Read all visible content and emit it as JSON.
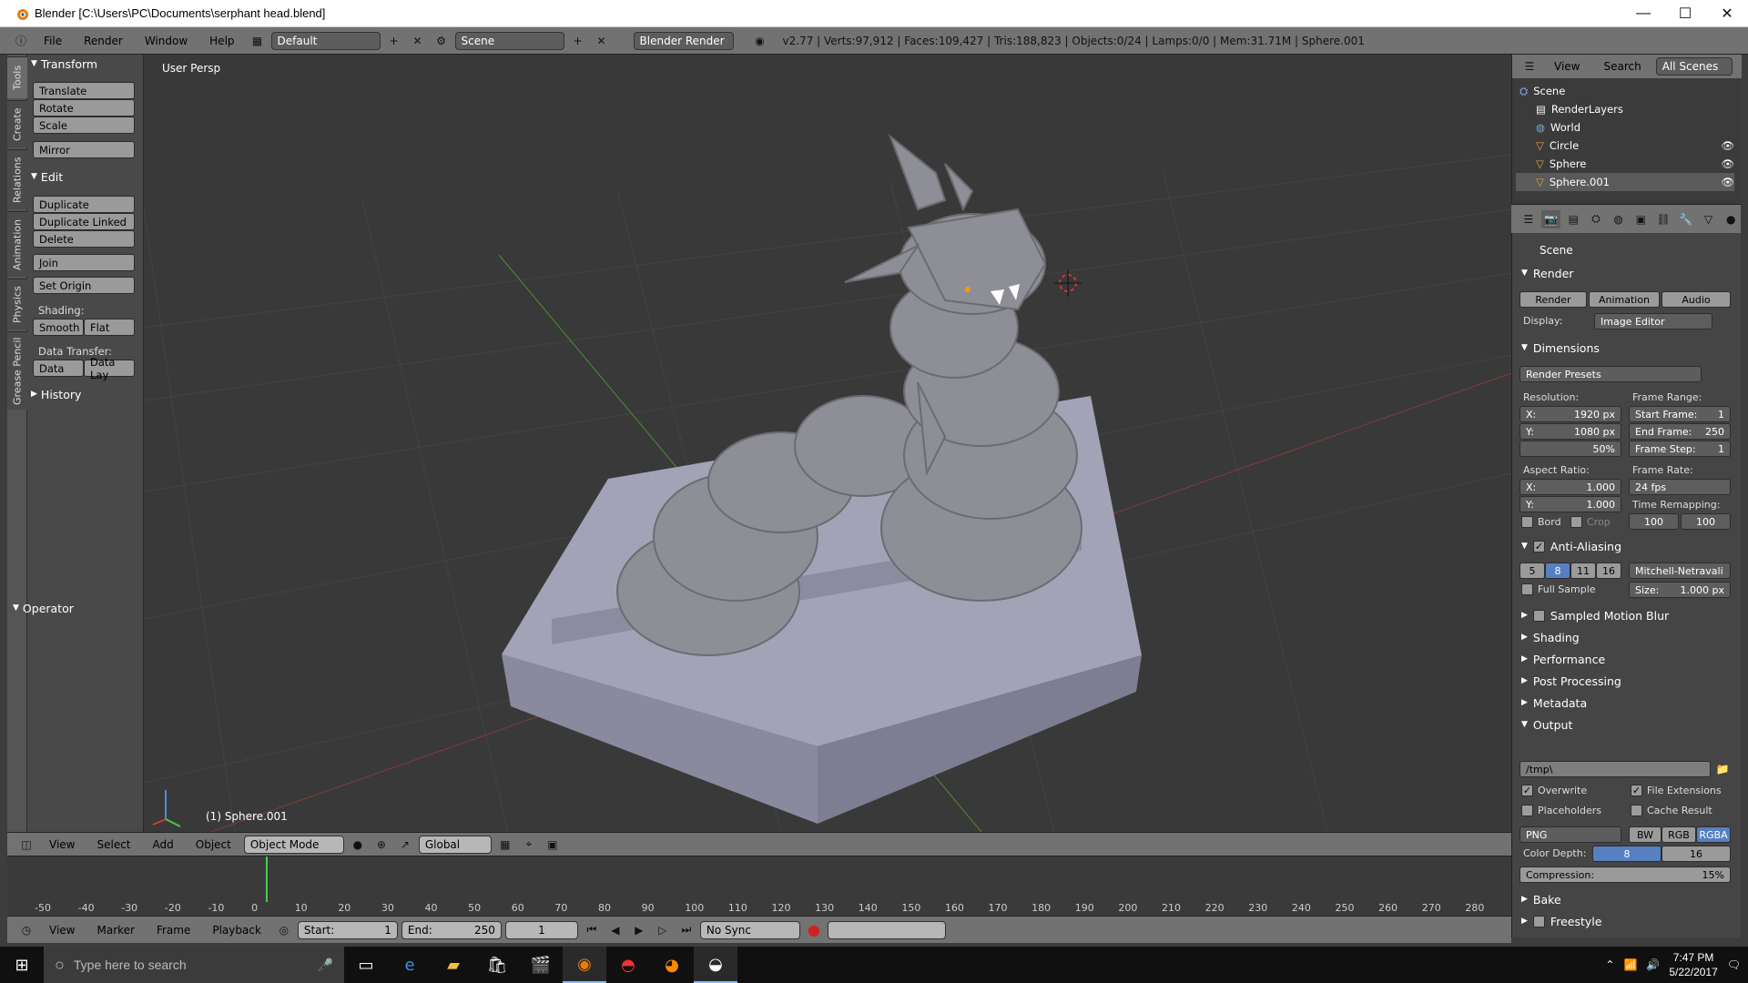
{
  "window": {
    "title": "Blender [C:\\Users\\PC\\Documents\\serphant head.blend]",
    "min": "—",
    "max": "☐",
    "close": "✕"
  },
  "info": {
    "menus": [
      "File",
      "Render",
      "Window",
      "Help"
    ],
    "layout": "Default",
    "scene": "Scene",
    "engine": "Blender Render",
    "stats": "v2.77 | Verts:97,912 | Faces:109,427 | Tris:188,823 | Objects:0/24 | Lamps:0/0 | Mem:31.71M | Sphere.001"
  },
  "vtabs": [
    "Tools",
    "Create",
    "Relations",
    "Animation",
    "Physics",
    "Grease Pencil"
  ],
  "toolshelf": {
    "transform_title": "Transform",
    "translate": "Translate",
    "rotate": "Rotate",
    "scale": "Scale",
    "mirror": "Mirror",
    "edit_title": "Edit",
    "duplicate": "Duplicate",
    "duplicate_linked": "Duplicate Linked",
    "delete": "Delete",
    "join": "Join",
    "set_origin": "Set Origin",
    "shading_label": "Shading:",
    "smooth": "Smooth",
    "flat": "Flat",
    "data_transfer_label": "Data Transfer:",
    "data": "Data",
    "data_lay": "Data Lay",
    "history_title": "History",
    "operator_title": "Operator"
  },
  "viewport": {
    "view_label": "User Persp",
    "object_label": "(1) Sphere.001"
  },
  "vphead": {
    "menus": [
      "View",
      "Select",
      "Add",
      "Object"
    ],
    "mode": "Object Mode",
    "orientation": "Global"
  },
  "timeline": {
    "ticks": [
      "-50",
      "-40",
      "-30",
      "-20",
      "-10",
      "0",
      "10",
      "20",
      "30",
      "40",
      "50",
      "60",
      "70",
      "80",
      "90",
      "100",
      "110",
      "120",
      "130",
      "140",
      "150",
      "160",
      "170",
      "180",
      "190",
      "200",
      "210",
      "220",
      "230",
      "240",
      "250",
      "260",
      "270",
      "280"
    ],
    "menus": [
      "View",
      "Marker",
      "Frame",
      "Playback"
    ],
    "start_label": "Start:",
    "start": "1",
    "end_label": "End:",
    "end": "250",
    "current": "1",
    "sync": "No Sync"
  },
  "outliner": {
    "menus": [
      "View",
      "Search"
    ],
    "filter": "All Scenes",
    "rows": [
      "Scene",
      "RenderLayers",
      "World",
      "Circle",
      "Sphere",
      "Sphere.001"
    ]
  },
  "props": {
    "context": "Scene",
    "render_title": "Render",
    "render_btn": "Render",
    "animation_btn": "Animation",
    "audio_btn": "Audio",
    "display_label": "Display:",
    "display_value": "Image Editor",
    "dimensions_title": "Dimensions",
    "render_presets": "Render Presets",
    "resolution_label": "Resolution:",
    "res_x": "X:",
    "res_x_val": "1920 px",
    "res_y": "Y:",
    "res_y_val": "1080 px",
    "res_pct": "50%",
    "frame_range_label": "Frame Range:",
    "start_frame": "Start Frame:",
    "start_frame_val": "1",
    "end_frame": "End Frame:",
    "end_frame_val": "250",
    "frame_step": "Frame Step:",
    "frame_step_val": "1",
    "aspect_label": "Aspect Ratio:",
    "asp_x": "X:",
    "asp_x_val": "1.000",
    "asp_y": "Y:",
    "asp_y_val": "1.000",
    "frame_rate_label": "Frame Rate:",
    "frame_rate_val": "24 fps",
    "time_remap_label": "Time Remapping:",
    "remap_old": "100",
    "remap_new": "100",
    "bord": "Bord",
    "crop": "Crop",
    "aa_title": "Anti-Aliasing",
    "aa_samples": [
      "5",
      "8",
      "11",
      "16"
    ],
    "aa_filter": "Mitchell-Netravali",
    "full_sample": "Full Sample",
    "size_label": "Size:",
    "size_val": "1.000 px",
    "motion_blur": "Sampled Motion Blur",
    "shading": "Shading",
    "performance": "Performance",
    "post_processing": "Post Processing",
    "metadata": "Metadata",
    "output_title": "Output",
    "output_path": "/tmp\\",
    "overwrite": "Overwrite",
    "file_ext": "File Extensions",
    "placeholders": "Placeholders",
    "cache_result": "Cache Result",
    "format": "PNG",
    "bw": "BW",
    "rgb": "RGB",
    "rgba": "RGBA",
    "color_depth_label": "Color Depth:",
    "depth_8": "8",
    "depth_16": "16",
    "compression_label": "Compression:",
    "compression_val": "15%",
    "bake": "Bake",
    "freestyle": "Freestyle"
  },
  "taskbar": {
    "search_placeholder": "Type here to search",
    "time": "7:47 PM",
    "date": "5/22/2017"
  },
  "colors": {
    "accent_blue": "#5680c2",
    "viewport_bg": "#393939",
    "model": "#9595a8"
  }
}
